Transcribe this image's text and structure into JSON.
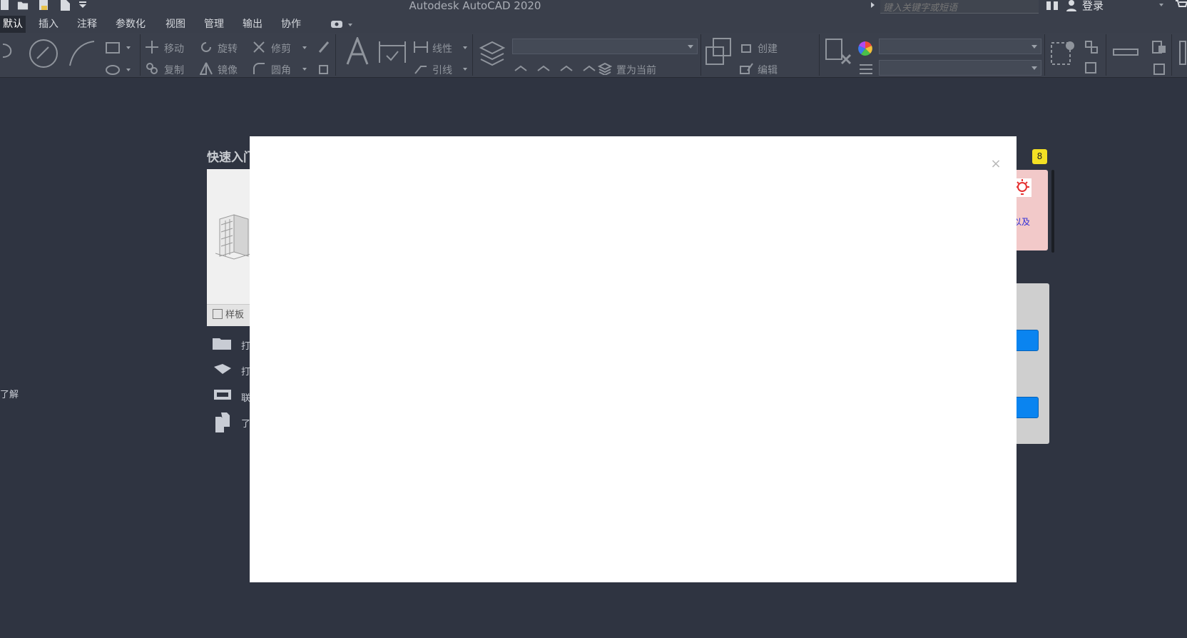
{
  "app": {
    "title": "Autodesk AutoCAD 2020",
    "search_placeholder": "键入关键字或短语",
    "login_label": "登录"
  },
  "tabs": [
    {
      "label": "默认",
      "active": true
    },
    {
      "label": "插入"
    },
    {
      "label": "注释"
    },
    {
      "label": "参数化"
    },
    {
      "label": "视图"
    },
    {
      "label": "管理"
    },
    {
      "label": "输出"
    },
    {
      "label": "协作"
    }
  ],
  "ribbon": {
    "modify": {
      "move": "移动",
      "rotate": "旋转",
      "trim": "修剪",
      "copy": "复制",
      "mirror": "镜像",
      "fillet": "圆角"
    },
    "annotation": {
      "linear": "线性",
      "leader": "引线"
    },
    "layers": {
      "set_current": "置为当前"
    },
    "block": {
      "create": "创建",
      "edit": "编辑"
    }
  },
  "start_page": {
    "quick_start_title": "快速入门",
    "template_label": "样板",
    "list_items": [
      "打",
      "打",
      "联",
      "了"
    ],
    "learn_label": "了解"
  },
  "notifications": {
    "count": "8",
    "card_text": "以及"
  },
  "colors": {
    "background": "#2f3441",
    "ribbon": "#3b404c",
    "modal": "#ffffff",
    "badge": "#f3e024",
    "accent_button": "#0a84f0"
  },
  "modal": {
    "close_glyph": "×"
  }
}
